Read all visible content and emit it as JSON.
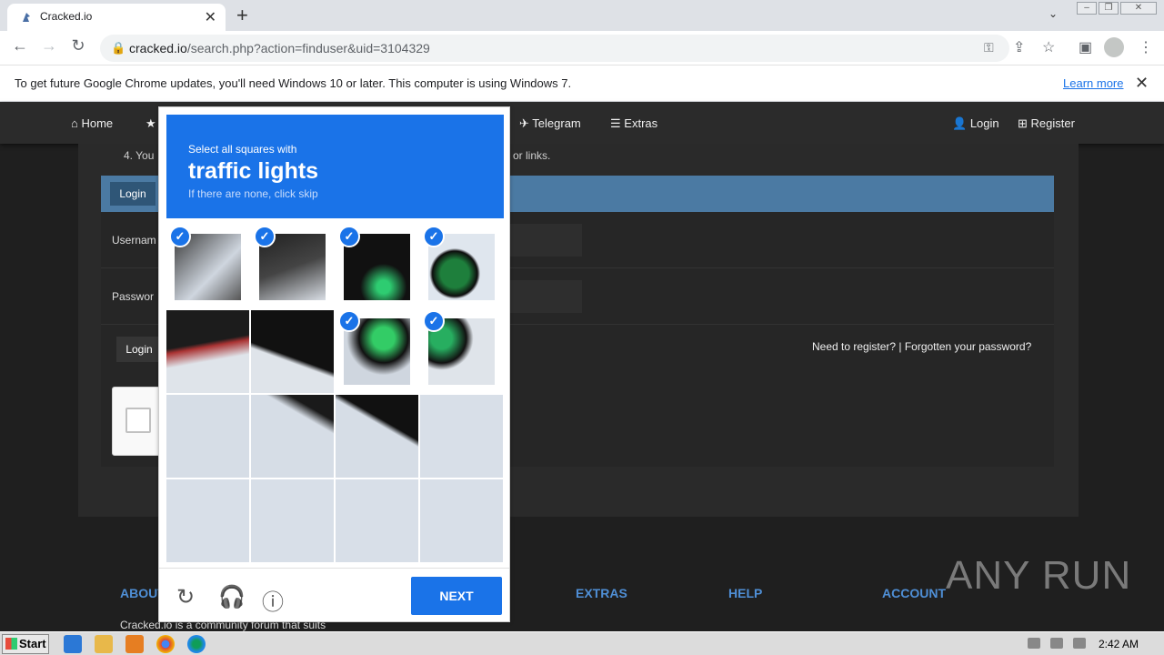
{
  "browser": {
    "tab_title": "Cracked.io",
    "url_host": "cracked.io",
    "url_path": "/search.php?action=finduser&uid=3104329",
    "infobar_text": "To get future Google Chrome updates, you'll need Windows 10 or later. This computer is using Windows 7.",
    "infobar_link": "Learn more"
  },
  "site": {
    "nav": [
      "Home",
      "Telegram",
      "Extras",
      "Login",
      "Register"
    ],
    "rule_left": "4. You",
    "rule_right": "or links.",
    "login_tab": "Login",
    "username_label": "Usernam",
    "password_label": "Passwor",
    "login_button": "Login",
    "register_text": "Need to register? | Forgotten your password?",
    "footer": [
      "ABOUT",
      "EXTRAS",
      "HELP",
      "ACCOUNT"
    ],
    "footer_text": "Cracked.io is a community forum that suits",
    "watermark": "ANY RUN"
  },
  "captcha": {
    "instruction": "Select all squares with",
    "target": "traffic lights",
    "hint": "If there are none, click skip",
    "next_label": "NEXT",
    "selected_tiles": [
      0,
      1,
      2,
      3,
      6,
      7
    ]
  },
  "taskbar": {
    "start_label": "Start",
    "clock": "2:42 AM"
  }
}
